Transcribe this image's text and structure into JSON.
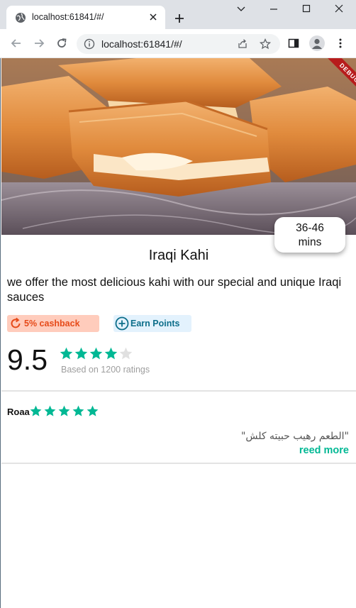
{
  "browser": {
    "tab_title": "localhost:61841/#/",
    "url": "localhost:61841/#/"
  },
  "icons": {
    "tab": "globe-icon",
    "tab_close": "close-icon",
    "new_tab": "plus-icon",
    "window": [
      "chevron-down-icon",
      "minimize-icon",
      "maximize-icon",
      "close-icon"
    ],
    "toolbar": [
      "back-icon",
      "forward-icon",
      "reload-icon",
      "info-icon",
      "share-icon",
      "star-icon",
      "sidepanel-icon",
      "profile-icon",
      "more-icon"
    ]
  },
  "app": {
    "debug_label": "DEBUG",
    "delivery_time": [
      "36-46",
      "mins"
    ],
    "title": "Iraqi Kahi",
    "description": "we offer the most delicious kahi with our special and unique Iraqi sauces",
    "cashback_label": "5% cashback",
    "earn_points_label": "Earn Points",
    "rating_score": "9.5",
    "rating_stars": 4,
    "rating_max": 5,
    "ratings_caption": "Based on 1200 ratings",
    "review": {
      "reviewer": "Roaa",
      "stars": 5,
      "text": "\"الطعم رهيب حبيته كلش\"",
      "read_more": "reed more"
    }
  },
  "colors": {
    "accent": "#00b894",
    "star_empty": "#e0e0e0",
    "cashback_bg": "#ffccbc",
    "cashback_text": "#e64a19",
    "earn_bg": "#e3f2fd",
    "earn_text": "#0d6e8a"
  }
}
